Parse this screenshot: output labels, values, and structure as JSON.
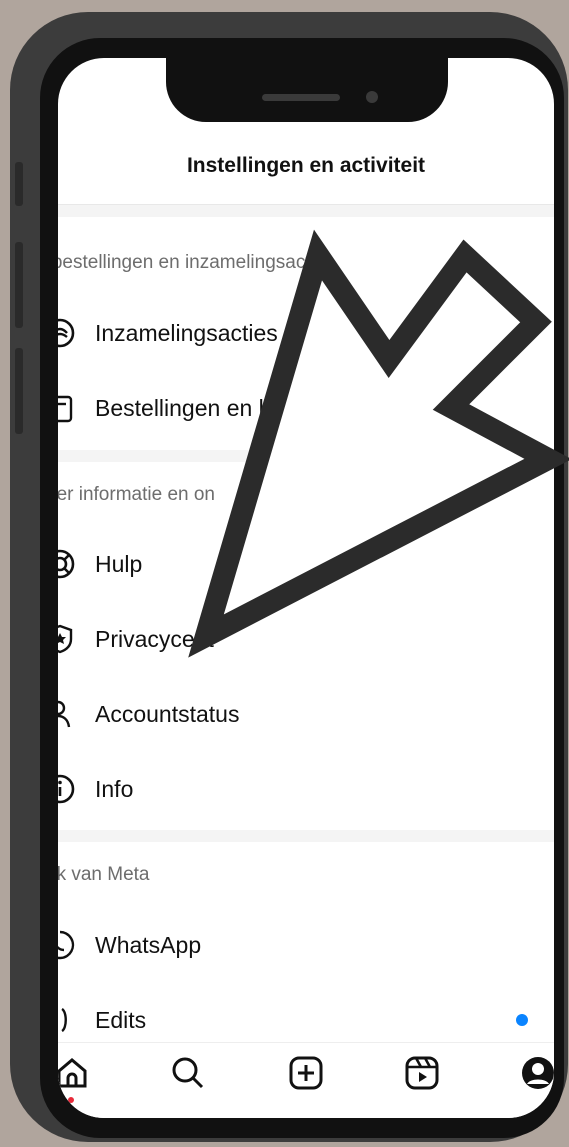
{
  "header": {
    "title": "Instellingen en activiteit"
  },
  "sections": {
    "orders": {
      "label": "e bestellingen en inzamelingsacties",
      "items": [
        {
          "label": "Inzamelingsacties",
          "icon": "fundraiser-icon"
        },
        {
          "label": "Bestellingen en be",
          "icon": "orders-icon"
        }
      ]
    },
    "info": {
      "label": "eer informatie en on",
      "items": [
        {
          "label": "Hulp",
          "icon": "help-lifebuoy-icon"
        },
        {
          "label": "Privacycent",
          "icon": "privacy-shield-icon"
        },
        {
          "label": "Accountstatus",
          "icon": "account-status-icon"
        },
        {
          "label": "Info",
          "icon": "info-icon"
        }
      ]
    },
    "meta": {
      "label": "ok van Meta",
      "items": [
        {
          "label": "WhatsApp",
          "icon": "whatsapp-icon"
        },
        {
          "label": "Edits",
          "icon": "edits-icon",
          "badge_color": "#0a84ff"
        }
      ]
    }
  },
  "tabbar": [
    "home-icon",
    "search-icon",
    "create-icon",
    "reels-icon",
    "profile-icon"
  ],
  "colors": {
    "background": "#b0a59d",
    "phone": "#3c3c3c",
    "arrow": "#2b2b2b",
    "badge": "#0a84ff",
    "home_indicator": "#e82a3a"
  }
}
